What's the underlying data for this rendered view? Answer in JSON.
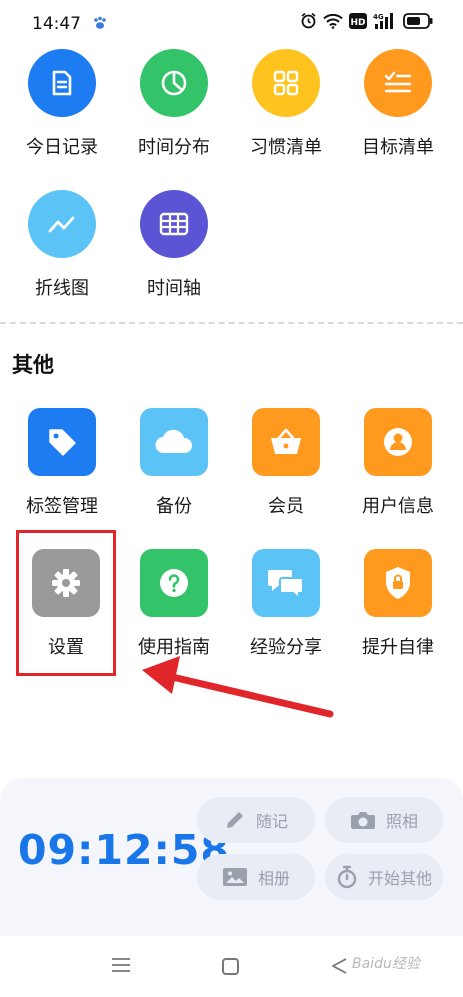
{
  "status_bar": {
    "time": "14:47",
    "network": "4G",
    "hd_badge": "HD"
  },
  "top_grid": [
    {
      "label": "今日记录",
      "icon": "document-icon",
      "color": "#1e7cf2"
    },
    {
      "label": "时间分布",
      "icon": "pie-chart-icon",
      "color": "#33c46a"
    },
    {
      "label": "习惯清单",
      "icon": "grid-icon",
      "color": "#ffc31f"
    },
    {
      "label": "目标清单",
      "icon": "checklist-icon",
      "color": "#ff9a1f"
    },
    {
      "label": "折线图",
      "icon": "line-chart-icon",
      "color": "#5cc3f7"
    },
    {
      "label": "时间轴",
      "icon": "table-icon",
      "color": "#5b55d6"
    }
  ],
  "other_section": {
    "title": "其他",
    "items": [
      {
        "label": "标签管理",
        "icon": "tag-icon",
        "color": "#1e7cf2"
      },
      {
        "label": "备份",
        "icon": "cloud-icon",
        "color": "#5cc3f7"
      },
      {
        "label": "会员",
        "icon": "basket-icon",
        "color": "#ff9a1f"
      },
      {
        "label": "用户信息",
        "icon": "user-icon",
        "color": "#ff9a1f"
      },
      {
        "label": "设置",
        "icon": "gear-icon",
        "color": "#999999"
      },
      {
        "label": "使用指南",
        "icon": "help-icon",
        "color": "#33c46a"
      },
      {
        "label": "经验分享",
        "icon": "chat-icon",
        "color": "#5cc3f7"
      },
      {
        "label": "提升自律",
        "icon": "shield-lock-icon",
        "color": "#ff9a1f"
      }
    ]
  },
  "bottom_panel": {
    "clock": "09:12:58",
    "actions": [
      {
        "label": "随记",
        "icon": "pencil-icon"
      },
      {
        "label": "照相",
        "icon": "camera-icon"
      },
      {
        "label": "相册",
        "icon": "image-icon"
      },
      {
        "label": "开始其他",
        "icon": "stopwatch-icon"
      }
    ]
  },
  "watermark": "Baidu经验"
}
